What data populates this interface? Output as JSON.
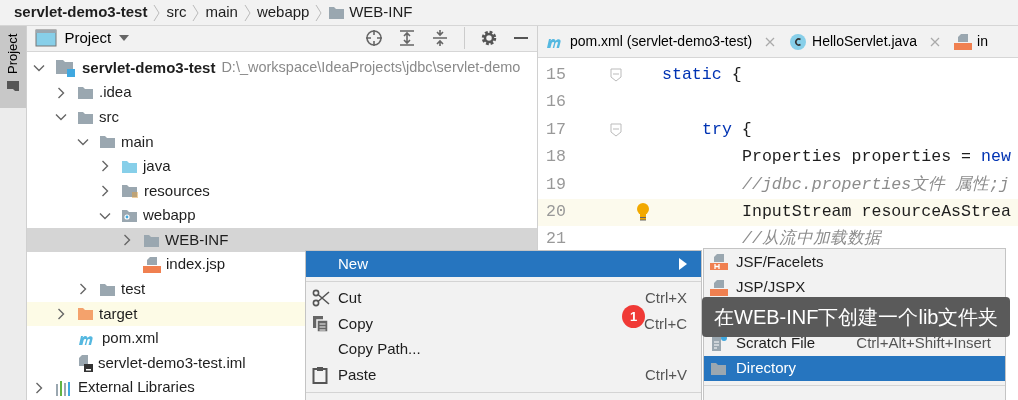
{
  "breadcrumbs": [
    {
      "label": "servlet-demo3-test",
      "kind": "project"
    },
    {
      "label": "src",
      "kind": "plain"
    },
    {
      "label": "main",
      "kind": "plain"
    },
    {
      "label": "webapp",
      "kind": "plain"
    },
    {
      "label": "WEB-INF",
      "kind": "folder"
    }
  ],
  "side_strip": {
    "tab": {
      "label": "Project",
      "selected": true
    }
  },
  "project_panel": {
    "title": "Project",
    "tree": [
      {
        "label": "servlet-demo3-test",
        "path": "D:\\_workspace\\IdeaProjects\\jdbc\\servlet-demo",
        "kind": "module",
        "expanded": true,
        "selected": false,
        "excluded": false,
        "children": [
          {
            "label": ".idea",
            "kind": "folder",
            "expanded": false,
            "selected": false,
            "excluded": false
          },
          {
            "label": "src",
            "kind": "folder",
            "expanded": true,
            "selected": false,
            "excluded": false,
            "children": [
              {
                "label": "main",
                "kind": "folder",
                "expanded": true,
                "selected": false,
                "excluded": false,
                "children": [
                  {
                    "label": "java",
                    "kind": "source",
                    "expanded": false,
                    "selected": false,
                    "excluded": false
                  },
                  {
                    "label": "resources",
                    "kind": "resources",
                    "expanded": false,
                    "selected": false,
                    "excluded": false
                  },
                  {
                    "label": "webapp",
                    "kind": "web",
                    "expanded": true,
                    "selected": false,
                    "excluded": false,
                    "children": [
                      {
                        "label": "WEB-INF",
                        "kind": "folder",
                        "expanded": false,
                        "selected": true,
                        "excluded": false
                      },
                      {
                        "label": "index.jsp",
                        "kind": "jsp",
                        "selected": false,
                        "excluded": false
                      }
                    ]
                  }
                ]
              },
              {
                "label": "test",
                "kind": "folder",
                "expanded": false,
                "selected": false,
                "excluded": false
              }
            ]
          },
          {
            "label": "target",
            "kind": "excluded-folder",
            "expanded": false,
            "selected": false,
            "excluded": true
          },
          {
            "label": "pom.xml",
            "kind": "maven",
            "selected": false,
            "excluded": false
          },
          {
            "label": "servlet-demo3-test.iml",
            "kind": "iml",
            "selected": false,
            "excluded": false
          }
        ]
      },
      {
        "label": "External Libraries",
        "kind": "libraries",
        "expanded": false,
        "selected": false,
        "excluded": false
      }
    ]
  },
  "editor": {
    "tabs": [
      {
        "label": "pom.xml (servlet-demo3-test)",
        "kind": "maven"
      },
      {
        "label": "HelloServlet.java",
        "kind": "class"
      },
      {
        "label": "in",
        "kind": "jsp"
      }
    ],
    "lines": [
      {
        "number": "15",
        "fold": true,
        "current": false,
        "bulb": false,
        "tokens": [
          {
            "kind": "keyword",
            "text": "static"
          },
          {
            "kind": "plain",
            "text": " {"
          }
        ],
        "children": [
          {
            "number": "16",
            "fold": false,
            "current": false,
            "bulb": false
          },
          {
            "number": "17",
            "fold": true,
            "current": false,
            "bulb": false,
            "tokens": [
              {
                "kind": "keyword",
                "text": "try"
              },
              {
                "kind": "plain",
                "text": " {"
              }
            ],
            "children": [
              {
                "number": "18",
                "fold": false,
                "current": false,
                "bulb": false,
                "tokens": [
                  {
                    "kind": "plain",
                    "text": "Properties properties = "
                  },
                  {
                    "kind": "keyword",
                    "text": "new"
                  }
                ]
              },
              {
                "number": "19",
                "fold": false,
                "current": false,
                "bulb": false,
                "tokens": [
                  {
                    "kind": "comment",
                    "text": "//jdbc.properties文件 属性;j"
                  }
                ]
              },
              {
                "number": "20",
                "fold": false,
                "current": true,
                "bulb": true,
                "tokens": [
                  {
                    "kind": "plain",
                    "text": "InputStream resourceAsStrea"
                  }
                ]
              },
              {
                "number": "21",
                "fold": false,
                "current": false,
                "bulb": false,
                "tokens": [
                  {
                    "kind": "comment",
                    "text": "//从流中加载数据"
                  }
                ]
              }
            ]
          }
        ]
      }
    ]
  },
  "context_menu": {
    "items": [
      {
        "label": "New",
        "kind": "submenu",
        "selected": true
      },
      {
        "kind": "separator"
      },
      {
        "label": "Cut",
        "shortcut": "Ctrl+X",
        "kind": "cut",
        "selected": false
      },
      {
        "label": "Copy",
        "shortcut": "Ctrl+C",
        "kind": "copy",
        "selected": false
      },
      {
        "label": "Copy Path...",
        "kind": "plain",
        "selected": false
      },
      {
        "label": "Paste",
        "shortcut": "Ctrl+V",
        "kind": "paste",
        "selected": false
      },
      {
        "kind": "separator"
      }
    ]
  },
  "submenu": {
    "items": [
      {
        "label": "JSF/Facelets",
        "kind": "jsf",
        "selected": false
      },
      {
        "label": "JSP/JSPX",
        "kind": "jsp",
        "selected": false
      },
      {
        "kind": "covered"
      },
      {
        "label": "Scratch File",
        "shortcut": "Ctrl+Alt+Shift+Insert",
        "kind": "scratch",
        "selected": false
      },
      {
        "label": "Directory",
        "kind": "directory",
        "selected": true
      },
      {
        "kind": "separator"
      }
    ]
  },
  "annotation": {
    "badge": "1",
    "text": "在WEB-INF下创建一个lib文件夹"
  }
}
